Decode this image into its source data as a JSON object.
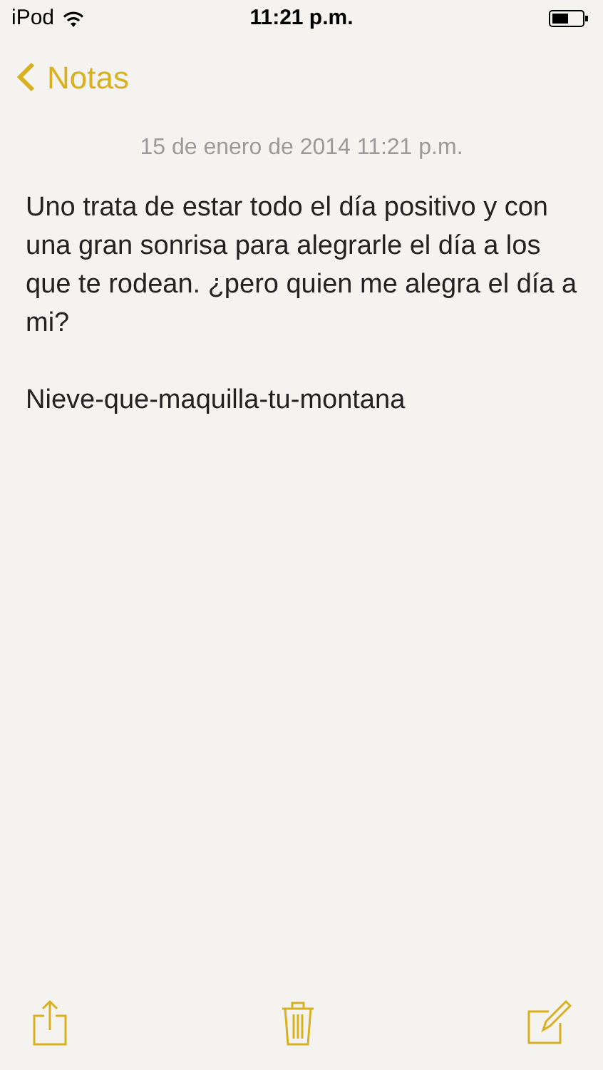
{
  "status_bar": {
    "carrier": "iPod",
    "time": "11:21 p.m."
  },
  "nav": {
    "back": "Notas"
  },
  "note": {
    "date": "15 de enero de 2014 11:21 p.m.",
    "paragraphs": [
      "Uno trata de estar todo el día positivo y con una gran sonrisa para alegrarle el día a los que te rodean. ¿pero quien me alegra el día a mi?",
      "Nieve-que-maquilla-tu-montana"
    ]
  },
  "toolbar": [
    {
      "kind": "share"
    },
    {
      "kind": "trash"
    },
    {
      "kind": "compose"
    }
  ]
}
